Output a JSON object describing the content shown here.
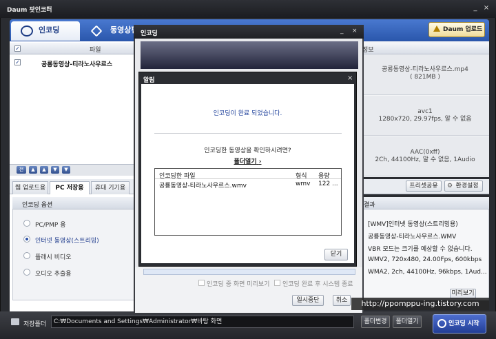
{
  "window": {
    "title": "Daum 팟인코더",
    "title_arrow": "▾",
    "minimize": "_",
    "close": "×"
  },
  "tabs": {
    "encode": "인코딩",
    "movie_edit": "동영상편"
  },
  "upgrade_label": "Daum 업로드",
  "file_list": {
    "header_checkbox": "✓",
    "header_label": "파일",
    "rows": [
      {
        "checked": "✓",
        "name": "공룡동영상-티라노사우르스"
      }
    ]
  },
  "arrow_buttons": [
    "전",
    "▲",
    "▲",
    "▼",
    "▼"
  ],
  "subtabs": {
    "web_upload": "웹 업로드용",
    "pc_save": "PC 저장용",
    "mobile": "휴대 기기용"
  },
  "options": {
    "header": "인코딩 옵션",
    "items": [
      {
        "label": "PC/PMP 용",
        "selected": false
      },
      {
        "label": "인터넷 동영상(스트리밍)",
        "selected": true
      },
      {
        "label": "플래시 비디오",
        "selected": false
      },
      {
        "label": "오디오 추출용",
        "selected": false
      }
    ]
  },
  "info": {
    "header": "정보",
    "file": "공룡동영상-티라노사우르스.mp4",
    "size": "( 821MB )",
    "video_codec": "avc1",
    "video_detail": "1280x720, 29.97fps, 알 수 없음",
    "audio_codec": "AAC(0xff)",
    "audio_detail": "2Ch, 44100Hz, 알 수 없음, 1Audio"
  },
  "preset_buttons": {
    "share": "프리셋공유",
    "settings": "환경설정"
  },
  "result": {
    "header": "결과",
    "lines": [
      "[WMV]인터넷 동영상(스트리밍용)",
      "공룡동영상-티라노사우르스.WMV",
      "VBR 모드는 크기를 예상할 수 없습니다.",
      "WMV2, 720x480, 24.00Fps, 600kbps",
      "WMA2, 2ch, 44100Hz, 96kbps, 1Aud..."
    ],
    "preview": "미리보기"
  },
  "bottom": {
    "folder_label": "저장폴더",
    "path": "C:₩Documents and Settings₩Administrator₩바탕 화면",
    "change_folder": "폴더변경",
    "open_folder": "폴더열기",
    "start": "인코딩 시작"
  },
  "encode_dialog": {
    "title": "인코딩",
    "minimize": "_",
    "close": "×",
    "check_preview": "인코딩 중 화면 미리보기",
    "check_shutdown": "인코딩 완료 후 시스템 종료",
    "pause": "일시중단",
    "cancel": "취소"
  },
  "alert": {
    "title": "알림",
    "close": "×",
    "message": "인코딩이 완료 되었습니다.",
    "question": "인코딩한 동영상을 확인하시려면?",
    "open_folder": "폴더열기",
    "open_folder_arrow": "›",
    "table": {
      "headers": [
        "인코딩한 파일",
        "형식",
        "용량"
      ],
      "rows": [
        [
          "공룡동영상-티라노사우르스.wmv",
          "wmv",
          "122 ..."
        ]
      ]
    },
    "close_button": "닫기"
  },
  "watermark": "http://ppomppu-ing.tistory.com"
}
